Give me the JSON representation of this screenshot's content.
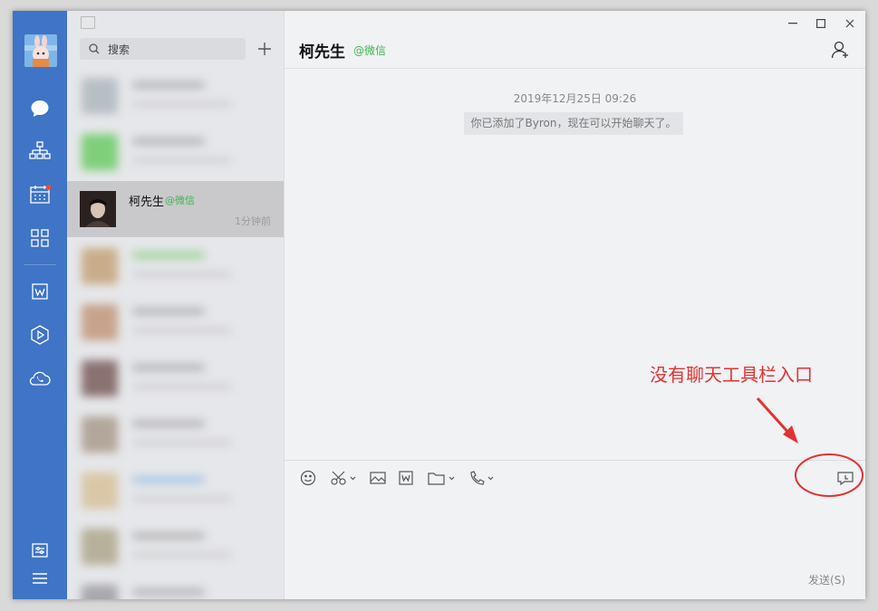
{
  "search": {
    "placeholder": "搜索"
  },
  "selected_chat": {
    "name": "柯先生",
    "tag": "@微信",
    "time": "1分钟前"
  },
  "chat": {
    "title": "柯先生",
    "tag": "@微信",
    "timestamp": "2019年12月25日 09:26",
    "system_message": "你已添加了Byron，现在可以开始聊天了。",
    "send_label": "发送(S)"
  },
  "annotation": {
    "text": "没有聊天工具栏入口",
    "color": "#e23232"
  },
  "colors": {
    "rail": "#3f74c6",
    "accent_green": "#3fb54c",
    "badge_red": "#f04a3c"
  },
  "icons": {
    "rail": [
      "chat-icon",
      "org-chart-icon",
      "calendar-icon",
      "apps-grid-icon",
      "doc-icon",
      "workbench-icon",
      "cloud-phone-icon",
      "settings-panel-icon",
      "menu-icon"
    ],
    "toolbar": [
      "emoji-icon",
      "scissors-icon",
      "image-icon",
      "word-doc-icon",
      "folder-icon",
      "phone-icon",
      "chat-history-icon"
    ]
  }
}
